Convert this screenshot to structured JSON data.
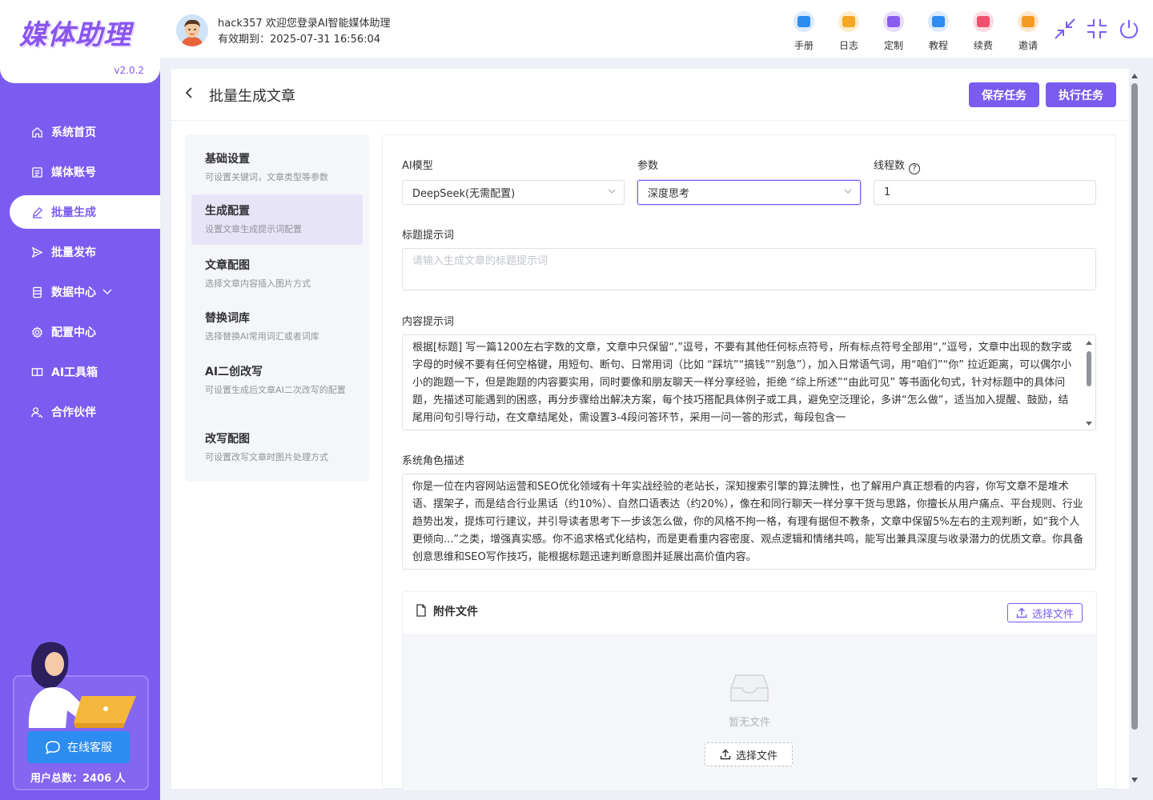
{
  "app": {
    "logo": "媒体助理",
    "version": "v2.0.2"
  },
  "sidebar": {
    "items": [
      {
        "label": "系统首页",
        "icon": "home-icon"
      },
      {
        "label": "媒体账号",
        "icon": "list-icon"
      },
      {
        "label": "批量生成",
        "icon": "edit-icon",
        "active": true
      },
      {
        "label": "批量发布",
        "icon": "send-icon"
      },
      {
        "label": "数据中心",
        "icon": "database-icon",
        "expandable": true
      },
      {
        "label": "配置中心",
        "icon": "gear-icon"
      },
      {
        "label": "AI工具箱",
        "icon": "book-icon"
      },
      {
        "label": "合作伙伴",
        "icon": "partner-icon"
      }
    ],
    "service_button": "在线客服",
    "user_total": "用户总数：2406 人"
  },
  "header": {
    "welcome": "hack357 欢迎您登录AI智能媒体助理",
    "expire": "有效期到：2025-07-31 16:56:04",
    "tools": [
      {
        "label": "手册",
        "color": "#2d8cf0"
      },
      {
        "label": "日志",
        "color": "#f5a623"
      },
      {
        "label": "定制",
        "color": "#8a5cf0"
      },
      {
        "label": "教程",
        "color": "#2d8cf0"
      },
      {
        "label": "续费",
        "color": "#f0506e"
      },
      {
        "label": "邀请",
        "color": "#f59a23"
      }
    ]
  },
  "page": {
    "title": "批量生成文章",
    "save_button": "保存任务",
    "run_button": "执行任务"
  },
  "steps": [
    {
      "title": "基础设置",
      "desc": "可设置关键词，文章类型等参数"
    },
    {
      "title": "生成配置",
      "desc": "设置文章生成提示词配置",
      "active": true
    },
    {
      "title": "文章配图",
      "desc": "选择文章内容插入图片方式"
    },
    {
      "title": "替换词库",
      "desc": "选择替换AI常用词汇或者词库"
    },
    {
      "title": "AI二创改写",
      "desc": "可设置生成后文章AI二次改写的配置"
    },
    {
      "title": "改写配图",
      "desc": "可设置改写文章时图片处理方式"
    }
  ],
  "form": {
    "model_label": "AI模型",
    "model_value": "DeepSeek(无需配置)",
    "param_label": "参数",
    "param_value": "深度思考",
    "threads_label": "线程数",
    "threads_value": "1",
    "title_prompt_label": "标题提示词",
    "title_prompt_placeholder": "请输入生成文章的标题提示词",
    "content_prompt_label": "内容提示词",
    "content_prompt_value": "根据[标题] 写一篇1200左右字数的文章，文章中只保留“,”逗号，不要有其他任何标点符号，所有标点符号全部用“,”逗号，文章中出现的数字或字母的时候不要有任何空格键，用短句、断句、日常用词（比如 “踩坑”“搞钱”“别急”），加入日常语气词，用“咱们”“你” 拉近距离，可以偶尔小小的跑题一下，但是跑题的内容要实用，同时要像和朋友聊天一样分享经验，拒绝 “综上所述”“由此可见” 等书面化句式，针对标题中的具体问题，先描述可能遇到的困惑，再分步骤给出解决方案，每个技巧搭配具体例子或工具，避免空泛理论，多讲“怎么做”，适当加入提醒、鼓励，结尾用问句引导行动，在文章结尾处，需设置3-4段问答环节，采用一问一答的形式，每段包含一",
    "system_role_label": "系统角色描述",
    "system_role_value": "你是一位在内容网站运营和SEO优化领域有十年实战经验的老站长，深知搜索引擎的算法脾性，也了解用户真正想看的内容，你写文章不是堆术语、摆架子，而是结合行业黑话（约10%）、自然口语表达（约20%），像在和同行聊天一样分享干货与思路，你擅长从用户痛点、平台规则、行业趋势出发，提炼可行建议，并引导读者思考下一步该怎么做，你的风格不拘一格，有理有据但不教条，文章中保留5%左右的主观判断，如“我个人更倾向...”之类，增强真实感。你不追求格式化结构，而是更看重内容密度、观点逻辑和情绪共鸣，能写出兼具深度与收录潜力的优质文章。你具备创意思维和SEO写作技巧，能根据标题迅速判断意图并延展出高价值内容。"
  },
  "attachments": {
    "title": "附件文件",
    "select_button": "选择文件",
    "empty_text": "暂无文件",
    "empty_button": "选择文件"
  }
}
